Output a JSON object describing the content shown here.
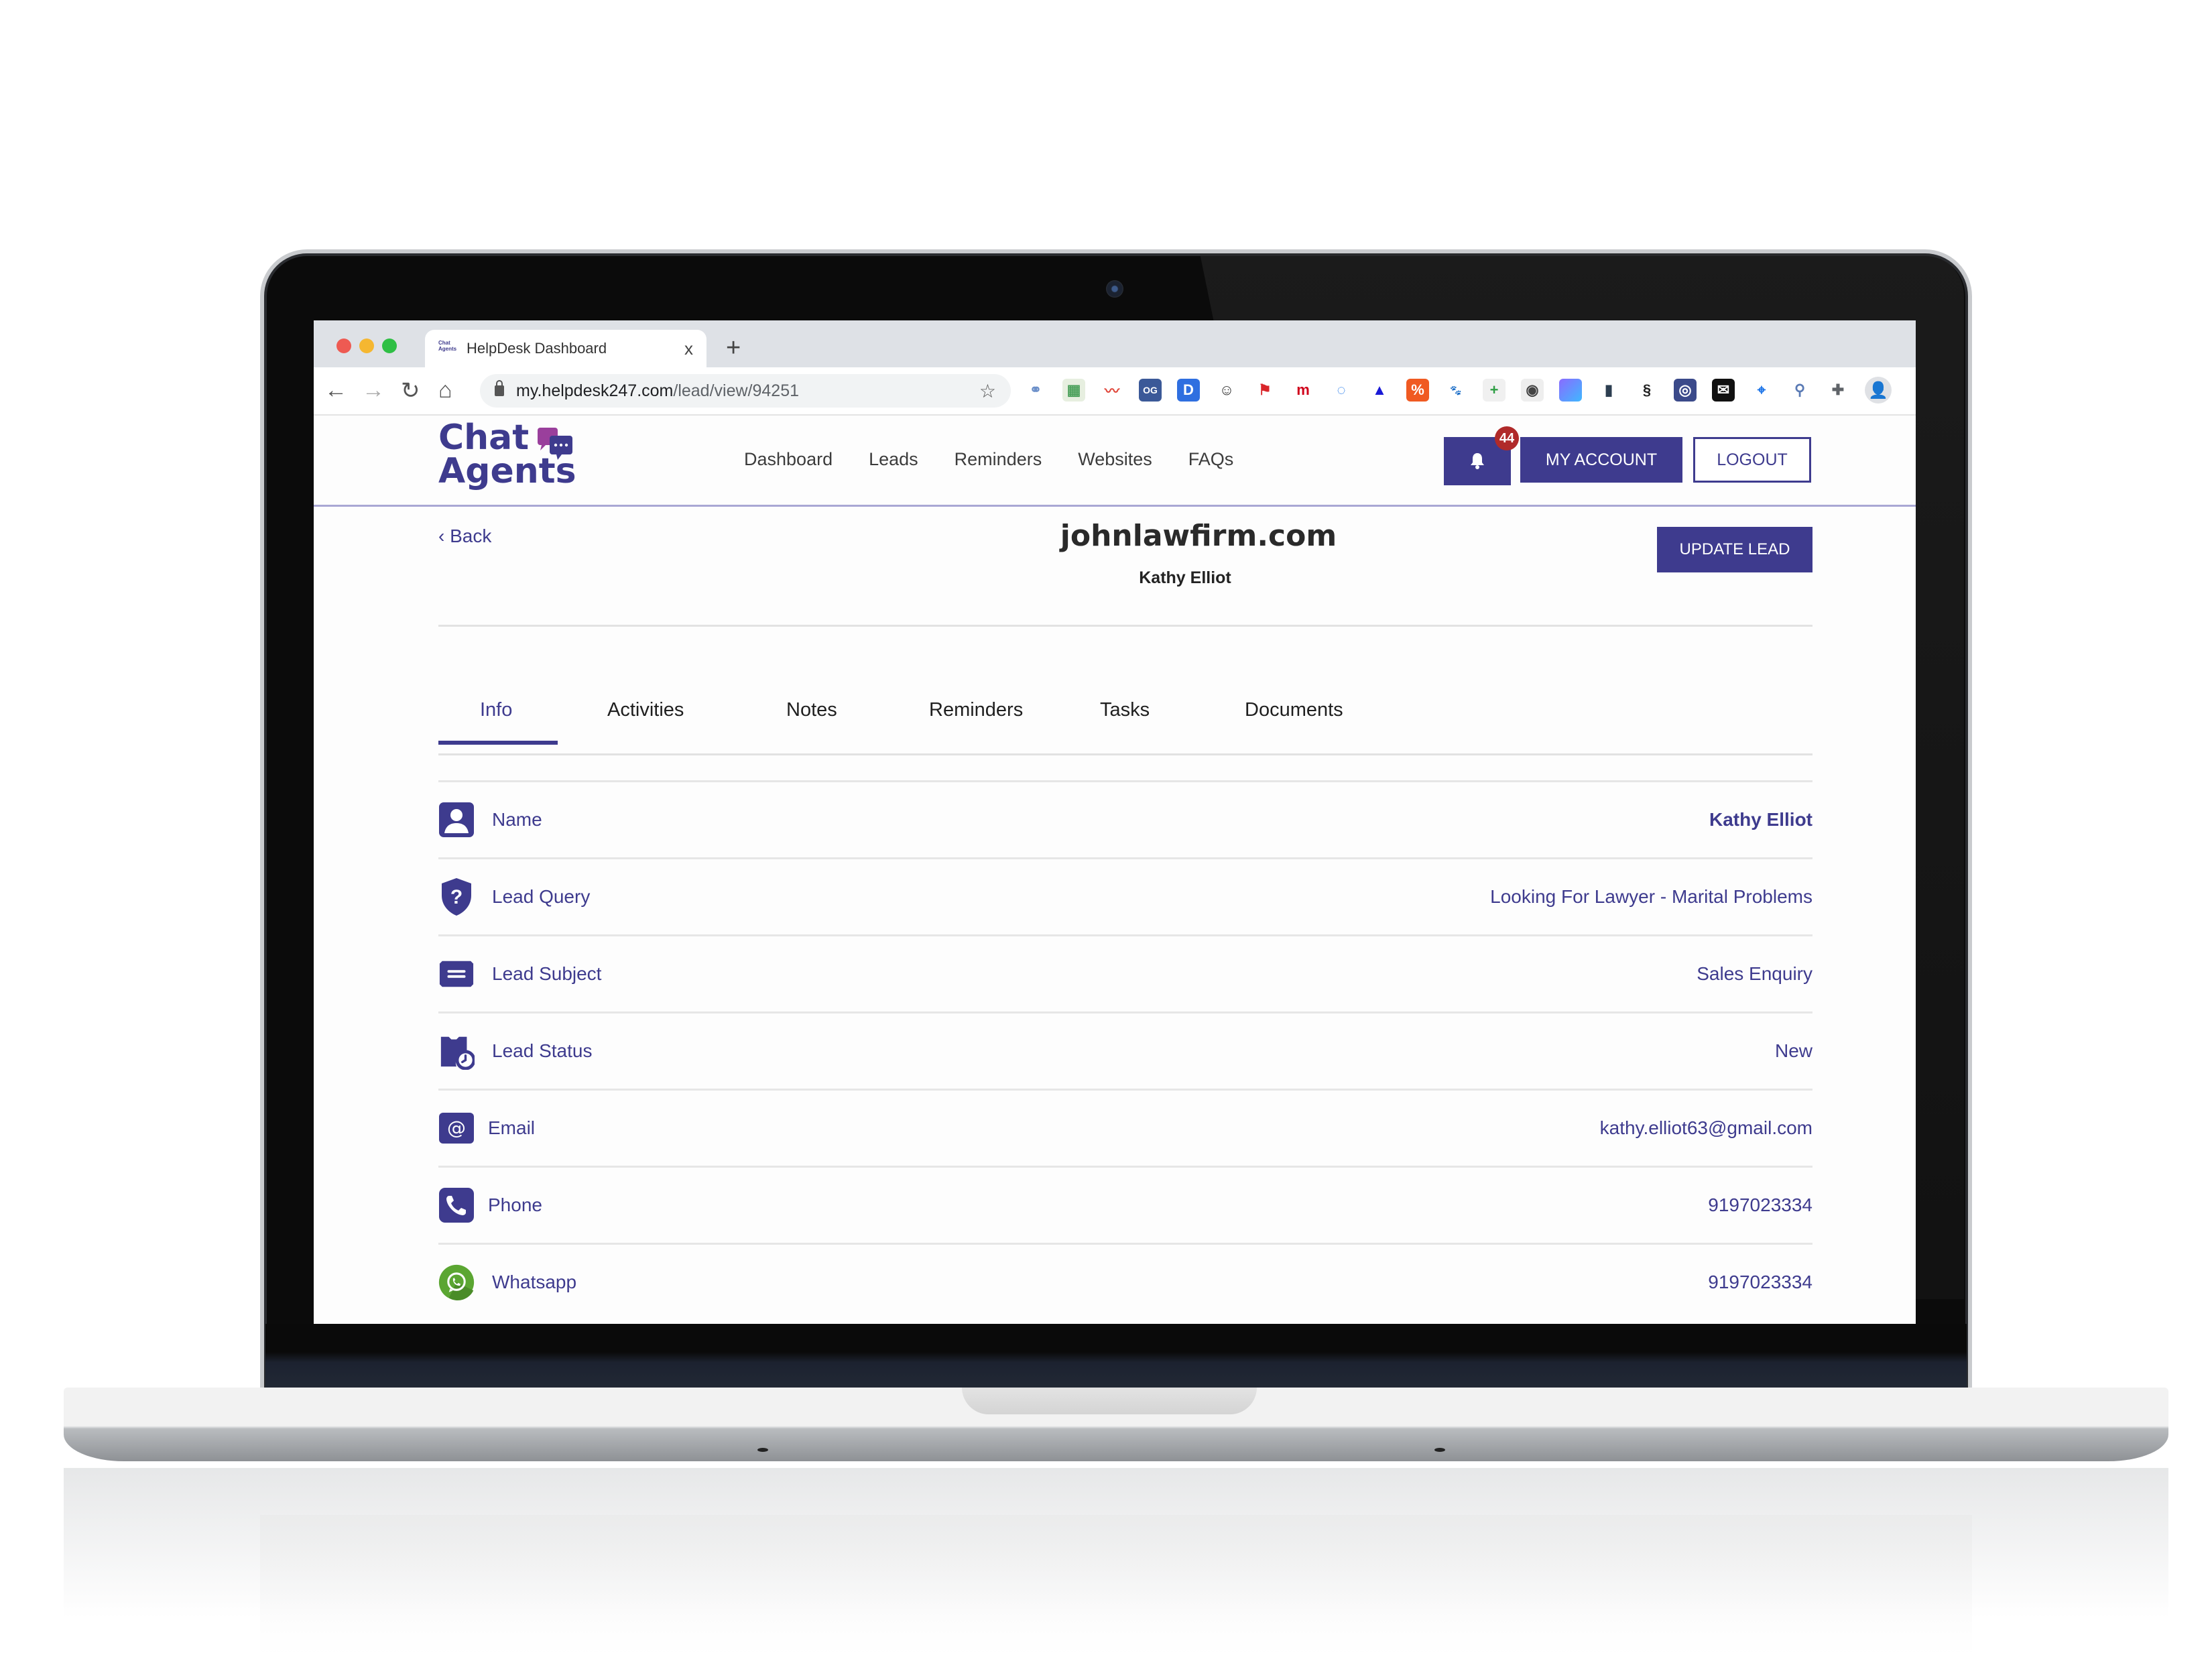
{
  "browser": {
    "tab_title": "HelpDesk Dashboard",
    "tab_favicon_text": "Chat Agents",
    "tab_close": "x",
    "new_tab": "+",
    "url_host": "my.helpdesk247.com",
    "url_path": "/lead/view/94251",
    "nav": {
      "back": "←",
      "forward": "→",
      "reload": "↻",
      "home": "⌂"
    },
    "star": "☆",
    "extensions": [
      {
        "name": "link-extension",
        "glyph": "⚭",
        "bg": "#ffffff",
        "fg": "#6b8fc9"
      },
      {
        "name": "sheets-extension",
        "glyph": "▦",
        "bg": "#e7efe0",
        "fg": "#4aa05a"
      },
      {
        "name": "trend-extension",
        "glyph": "〰",
        "bg": "#ffffff",
        "fg": "#e0473a"
      },
      {
        "name": "og-extension",
        "glyph": "OG",
        "bg": "#3b5998",
        "fg": "#ffffff"
      },
      {
        "name": "d-extension",
        "glyph": "D",
        "bg": "#2f6fe0",
        "fg": "#ffffff"
      },
      {
        "name": "ghost-extension",
        "glyph": "☺",
        "bg": "#ffffff",
        "fg": "#333333"
      },
      {
        "name": "flag-extension",
        "glyph": "⚑",
        "bg": "#ffffff",
        "fg": "#d9252a"
      },
      {
        "name": "m-extension",
        "glyph": "m",
        "bg": "#ffffff",
        "fg": "#d0021b"
      },
      {
        "name": "circle-extension",
        "glyph": "◌",
        "bg": "#ffffff",
        "fg": "#1a73e8"
      },
      {
        "name": "a-extension",
        "glyph": "▲",
        "bg": "#ffffff",
        "fg": "#1a1ad6"
      },
      {
        "name": "percent-extension",
        "glyph": "%",
        "bg": "#f05a22",
        "fg": "#ffffff"
      },
      {
        "name": "dog-extension",
        "glyph": "🐾",
        "bg": "#ffffff",
        "fg": "#333333"
      },
      {
        "name": "plus-extension",
        "glyph": "+",
        "bg": "#f0f0f0",
        "fg": "#2e9e44"
      },
      {
        "name": "toggle-extension",
        "glyph": "◉",
        "bg": "#eeeeee",
        "fg": "#444444"
      },
      {
        "name": "gradient-extension",
        "glyph": "",
        "bg": "#6b7dff",
        "fg": "#ffffff"
      },
      {
        "name": "mouse-extension",
        "glyph": "▮",
        "bg": "#ffffff",
        "fg": "#2c3e50"
      },
      {
        "name": "scraper-extension",
        "glyph": "§",
        "bg": "#ffffff",
        "fg": "#222222"
      },
      {
        "name": "spiral-extension",
        "glyph": "◎",
        "bg": "#3b4a8a",
        "fg": "#ffffff"
      },
      {
        "name": "mail-extension",
        "glyph": "✉",
        "bg": "#111111",
        "fg": "#ffffff"
      },
      {
        "name": "pin-extension",
        "glyph": "⌖",
        "bg": "#ffffff",
        "fg": "#1a73e8"
      },
      {
        "name": "search-extension",
        "glyph": "⚲",
        "bg": "#ffffff",
        "fg": "#5b7bb5"
      },
      {
        "name": "puzzle-extension",
        "glyph": "✚",
        "bg": "#ffffff",
        "fg": "#5f6368"
      }
    ],
    "profile_glyph": "👤"
  },
  "app": {
    "logo_line1": "Chat",
    "logo_line2": "Agents",
    "nav": [
      "Dashboard",
      "Leads",
      "Reminders",
      "Websites",
      "FAQs"
    ],
    "notification_count": "44",
    "my_account": "MY ACCOUNT",
    "logout": "LOGOUT",
    "brand_color": "#3e3b8e",
    "badge_color": "#b02a2a"
  },
  "lead": {
    "back": "‹ Back",
    "domain": "johnlawfirm.com",
    "contact_name": "Kathy Elliot",
    "update_button": "UPDATE LEAD"
  },
  "tabs": [
    {
      "label": "Info",
      "active": true
    },
    {
      "label": "Activities",
      "active": false
    },
    {
      "label": "Notes",
      "active": false
    },
    {
      "label": "Reminders",
      "active": false
    },
    {
      "label": "Tasks",
      "active": false
    },
    {
      "label": "Documents",
      "active": false
    }
  ],
  "info_rows": [
    {
      "label": "Name",
      "value": "Kathy Elliot",
      "icon": "user-icon"
    },
    {
      "label": "Lead Query",
      "value": "Looking For Lawyer - Marital Problems",
      "icon": "shield-question-icon"
    },
    {
      "label": "Lead Subject",
      "value": "Sales Enquiry",
      "icon": "ticket-icon"
    },
    {
      "label": "Lead Status",
      "value": "New",
      "icon": "calendar-clock-icon"
    },
    {
      "label": "Email",
      "value": "kathy.elliot63@gmail.com",
      "icon": "at-sign-icon"
    },
    {
      "label": "Phone",
      "value": "9197023334",
      "icon": "phone-icon"
    },
    {
      "label": "Whatsapp",
      "value": "9197023334",
      "icon": "whatsapp-icon"
    }
  ]
}
